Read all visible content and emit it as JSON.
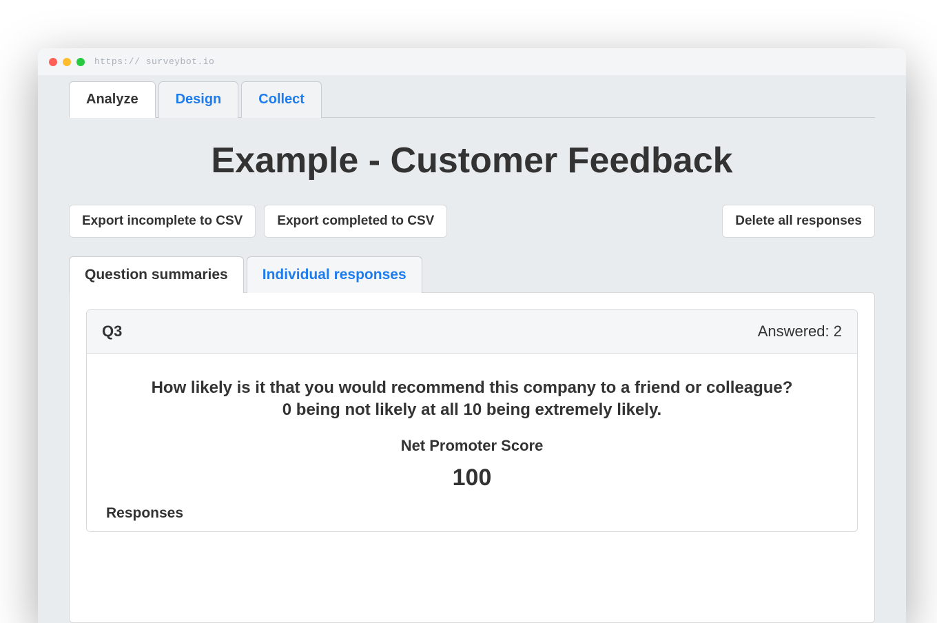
{
  "browser": {
    "url_protocol": "https://",
    "url_host": "surveybot.io"
  },
  "tabs": {
    "analyze": "Analyze",
    "design": "Design",
    "collect": "Collect"
  },
  "page": {
    "title": "Example - Customer Feedback"
  },
  "actions": {
    "export_incomplete": "Export incomplete to CSV",
    "export_completed": "Export completed to CSV",
    "delete_all": "Delete all responses"
  },
  "sub_tabs": {
    "summaries": "Question summaries",
    "individual": "Individual responses"
  },
  "question": {
    "number": "Q3",
    "answered_label": "Answered: 2",
    "text_line1": "How likely is it that you would recommend this company to a friend or colleague?",
    "text_line2": "0 being not likely at all 10 being extremely likely.",
    "nps_label": "Net Promoter Score",
    "nps_score": "100",
    "responses_heading": "Responses"
  }
}
